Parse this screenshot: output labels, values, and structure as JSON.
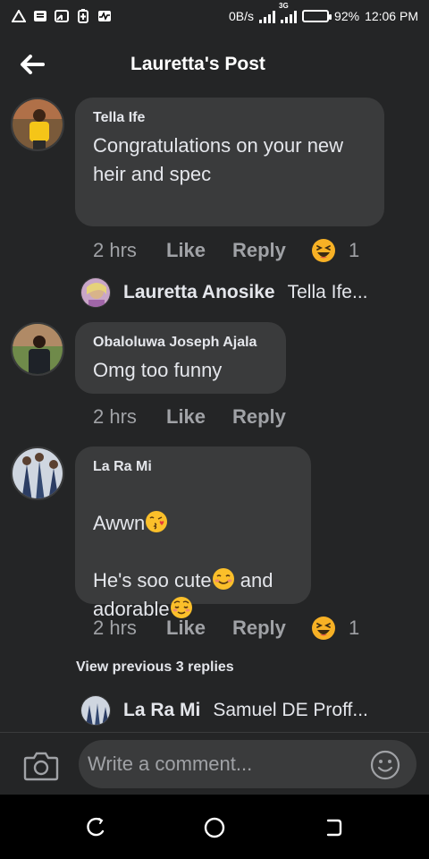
{
  "status_bar": {
    "network_speed": "0B/s",
    "network_type": "3G",
    "battery": "92%",
    "battery_level": 0.92,
    "time": "12:06 PM",
    "icons": [
      "warning-triangle-icon",
      "message-icon",
      "cast-icon",
      "battery-saver-icon",
      "activity-icon"
    ]
  },
  "header": {
    "title": "Lauretta's Post",
    "back_icon": "arrow-left-icon"
  },
  "comments": [
    {
      "author": "Tella Ife",
      "text": "Congratulations on your new heir and spec",
      "time": "2 hrs",
      "like_label": "Like",
      "reply_label": "Reply",
      "reaction_icon": "haha-reaction-icon",
      "reaction_count": "1",
      "reply_preview": {
        "author": "Lauretta Anosike",
        "text": "Tella Ife..."
      }
    },
    {
      "author": "Obaloluwa Joseph Ajala",
      "text": "Omg too funny",
      "time": "2 hrs",
      "like_label": "Like",
      "reply_label": "Reply"
    },
    {
      "author": "La Ra Mi",
      "line1": "Awwn",
      "line2": "He's soo cute",
      "line2b": " and",
      "line3": "adorable",
      "emojis": [
        "kiss-emoji-icon",
        "smiling-emoji-icon",
        "relieved-emoji-icon"
      ],
      "time": "2 hrs",
      "like_label": "Like",
      "reply_label": "Reply",
      "reaction_icon": "haha-reaction-icon",
      "reaction_count": "1",
      "view_previous": "View previous 3 replies",
      "reply_preview": {
        "author": "La Ra Mi",
        "text": "Samuel DE Proff..."
      }
    }
  ],
  "composer": {
    "placeholder": "Write a comment...",
    "camera_icon": "camera-icon",
    "emoji_icon": "emoji-icon"
  },
  "navbar": {
    "icons": [
      "recent-apps-icon",
      "home-icon",
      "back-icon"
    ]
  },
  "colors": {
    "background": "#242526",
    "bubble": "#3a3b3c",
    "text": "#e4e6eb",
    "muted": "#a0a2a6",
    "navbar": "#000000"
  }
}
